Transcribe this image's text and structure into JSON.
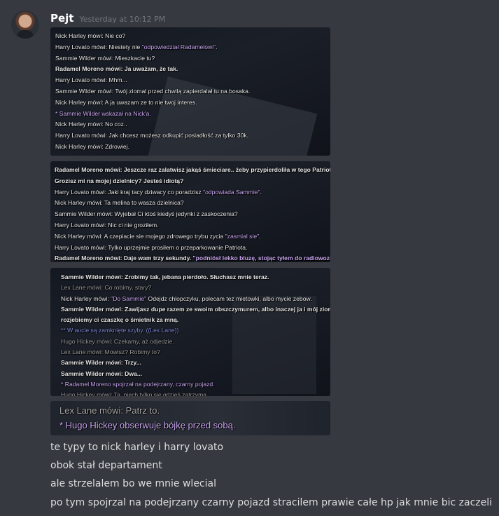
{
  "message": {
    "username": "Pejt",
    "timestamp": "Yesterday at 10:12 PM"
  },
  "screenshot1": [
    {
      "text": "Nick Harley mówi: Nie co?"
    },
    {
      "text": "Harry Lovato mówi: Niestety nie ",
      "act": "\"odpowiedział Radamelowi\"",
      "tail": "."
    },
    {
      "text": "Sammie Wilder mówi: Mieszkacie tu?"
    },
    {
      "text": "Radamel Moreno mówi: Ja uważam, że tak.",
      "bold": true
    },
    {
      "text": "Harry Lovato mówi: Mhm..."
    },
    {
      "text": "Sammie Wilder mówi: Twój ziomal przed chwilą zapierdalał tu na bosaka."
    },
    {
      "text": "Nick Harley mówi: A ja uwazam ze to nie twoj interes."
    },
    {
      "text": "* Sammie Wilder wskazał na Nick'a.",
      "me": true
    },
    {
      "text": "Nick Harley mówi: No coz.."
    },
    {
      "text": "Harry Lovato mówi: Jak chcesz możesz odkupić posiadłość za tylko 30k."
    },
    {
      "text": "Nick Harley mówi: Zdrowiej."
    }
  ],
  "screenshot2": [
    {
      "text": "Radamel Moreno mówi: Jeszcze raz zalatwisz jakąś śmieciare.. żeby przypierdoliła w tego Patriota..",
      "bold": true
    },
    {
      "text": "Grozisz mi na mojej dzielnicy? Jesteś idiotą?",
      "bold": true
    },
    {
      "text": "Harry Lovato mówi: Jaki kraj tacy dziwacy co poradzisz ",
      "act": "\"odpowiada Sammie\"",
      "tail": "."
    },
    {
      "text": "Nick Harley mówi: Ta melina to wasza dzielnica?"
    },
    {
      "text": "Sammie Wilder mówi: Wyjebał Ci ktoś kiedyś jedynki z zaskoczenia?"
    },
    {
      "text": "Harry Lovato mówi: Nic ci nie groziłem."
    },
    {
      "text": "Nick Harley mówi: A czepiacie sie mojego zdrowego trybu zycia ",
      "act": "\"zasmial sie\"",
      "tail": "."
    },
    {
      "text": "Harry Lovato mówi: Tylko uprzejmie prosiłem o przeparkowanie Patriota."
    },
    {
      "text": "Radamel Moreno mówi: Daje wam trzy sekundy. ",
      "act": "\"podniósł lekko bluzę, stojąc tyłem do radiowozu\"",
      "tail": ".",
      "bold": true
    }
  ],
  "screenshot3": [
    {
      "text": "Sammie Wilder mówi: Zrobimy tak, jebana pierdoło. Słuchasz mnie teraz.",
      "bold": true
    },
    {
      "text": "Lex Lane mówi: Co robimy, stary?",
      "dim": true
    },
    {
      "text": "Nick Harley mówi: ",
      "act": "\"Do Sammie\"",
      "tail": " Odejdz chlopczyku, polecam tez mietowki, albo mycie zebow."
    },
    {
      "text": "Sammie Wilder mówi: Zawijasz dupe razem ze swoim obszczymurem, albo inaczej ja i mój ziomal",
      "bold": true
    },
    {
      "text": "rozjebiemy ci czaszkę o śmietnik za mną.",
      "bold": true
    },
    {
      "text": "** W aucie są zamknięte szyby. ((Lex Lane))",
      "ooc": true
    },
    {
      "text": "Hugo Hickey mówi: Czekamy, aż odjedzie.",
      "dim": true
    },
    {
      "text": "Lex Lane mówi: Mowisz? Robimy to?",
      "dim": true
    },
    {
      "text": "Sammie Wilder mówi: Trzy...",
      "bold": true
    },
    {
      "text": "Sammie Wilder mówi: Dwa...",
      "bold": true
    },
    {
      "text": "* Radamel Moreno spojrzał na podejrzany, czarny pojazd.",
      "me": true
    },
    {
      "text": "Hugo Hickey mówi: Ta, niech tylko się gdzieś zatrzyma.",
      "dim": true
    }
  ],
  "screenshot4": [
    {
      "text": "Lex Lane mówi: Patrz to."
    },
    {
      "text": "* Hugo Hickey obserwuje bójkę przed sobą.",
      "me": true
    }
  ],
  "text_lines": [
    "te typy to nick harley i harry lovato",
    "obok stał departament",
    "ale strzelalem bo we mnie wlecial",
    "po tym spojrzal na podejrzany czarny pojazd stracilem prawie całe hp jak mnie bic zaczeli"
  ]
}
